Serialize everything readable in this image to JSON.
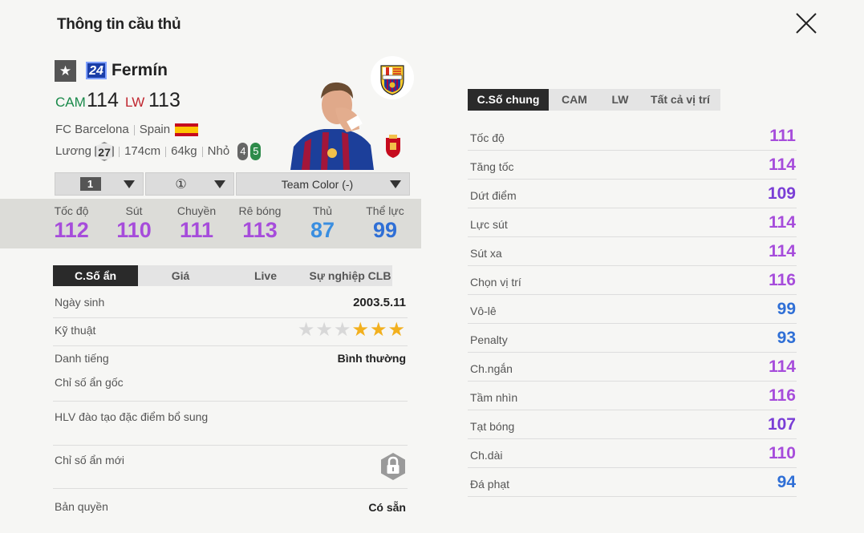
{
  "header": {
    "title": "Thông tin cầu thủ"
  },
  "player": {
    "season_badge": "24",
    "name": "Fermín",
    "positions": [
      {
        "pos": "CAM",
        "ovr": "114",
        "color": "#1a8a4a"
      },
      {
        "pos": "LW",
        "ovr": "113",
        "color": "#c0262f"
      }
    ],
    "club": "FC Barcelona",
    "nation": "Spain",
    "salary_label": "Lương",
    "salary": "27",
    "height": "174cm",
    "weight": "64kg",
    "body_type": "Nhỏ",
    "weak_foot": "4",
    "skill": "5"
  },
  "dropdowns": {
    "level": "1",
    "boost": "①",
    "team_color": "Team Color (-)"
  },
  "summary": [
    {
      "label": "Tốc độ",
      "value": "112",
      "color": "#a64cdb"
    },
    {
      "label": "Sút",
      "value": "110",
      "color": "#a64cdb"
    },
    {
      "label": "Chuyền",
      "value": "111",
      "color": "#a64cdb"
    },
    {
      "label": "Rê bóng",
      "value": "113",
      "color": "#a64cdb"
    },
    {
      "label": "Thủ",
      "value": "87",
      "color": "#3a8ee0"
    },
    {
      "label": "Thể lực",
      "value": "99",
      "color": "#2f6fd6"
    }
  ],
  "left_tabs": [
    "C.Số ẩn",
    "Giá",
    "Live",
    "Sự nghiệp CLB"
  ],
  "info": {
    "birth_label": "Ngày sinh",
    "birth": "2003.5.11",
    "technique_label": "Kỹ thuật",
    "technique_stars": 3,
    "reputation_label": "Danh tiếng",
    "reputation": "Bình thường",
    "hidden_orig_label": "Chỉ số ẩn gốc",
    "coach_label": "HLV đào tạo đặc điểm bổ sung",
    "hidden_new_label": "Chỉ số ẩn mới",
    "rights_label": "Bản quyền",
    "rights": "Có sẵn"
  },
  "right_tabs": [
    "C.Số chung",
    "CAM",
    "LW",
    "Tất cả vị trí"
  ],
  "stats": [
    {
      "label": "Tốc độ",
      "value": "111",
      "color": "#a64cdb"
    },
    {
      "label": "Tăng tốc",
      "value": "114",
      "color": "#a64cdb"
    },
    {
      "label": "Dứt điểm",
      "value": "109",
      "color": "#7a3ed6"
    },
    {
      "label": "Lực sút",
      "value": "114",
      "color": "#a64cdb"
    },
    {
      "label": "Sút xa",
      "value": "114",
      "color": "#a64cdb"
    },
    {
      "label": "Chọn vị trí",
      "value": "116",
      "color": "#a64cdb"
    },
    {
      "label": "Vô-lê",
      "value": "99",
      "color": "#2f6fd6"
    },
    {
      "label": "Penalty",
      "value": "93",
      "color": "#2f6fd6"
    },
    {
      "label": "Ch.ngắn",
      "value": "114",
      "color": "#a64cdb"
    },
    {
      "label": "Tầm nhìn",
      "value": "116",
      "color": "#a64cdb"
    },
    {
      "label": "Tạt bóng",
      "value": "107",
      "color": "#7a3ed6"
    },
    {
      "label": "Ch.dài",
      "value": "110",
      "color": "#a64cdb"
    },
    {
      "label": "Đá phạt",
      "value": "94",
      "color": "#2f6fd6"
    }
  ]
}
